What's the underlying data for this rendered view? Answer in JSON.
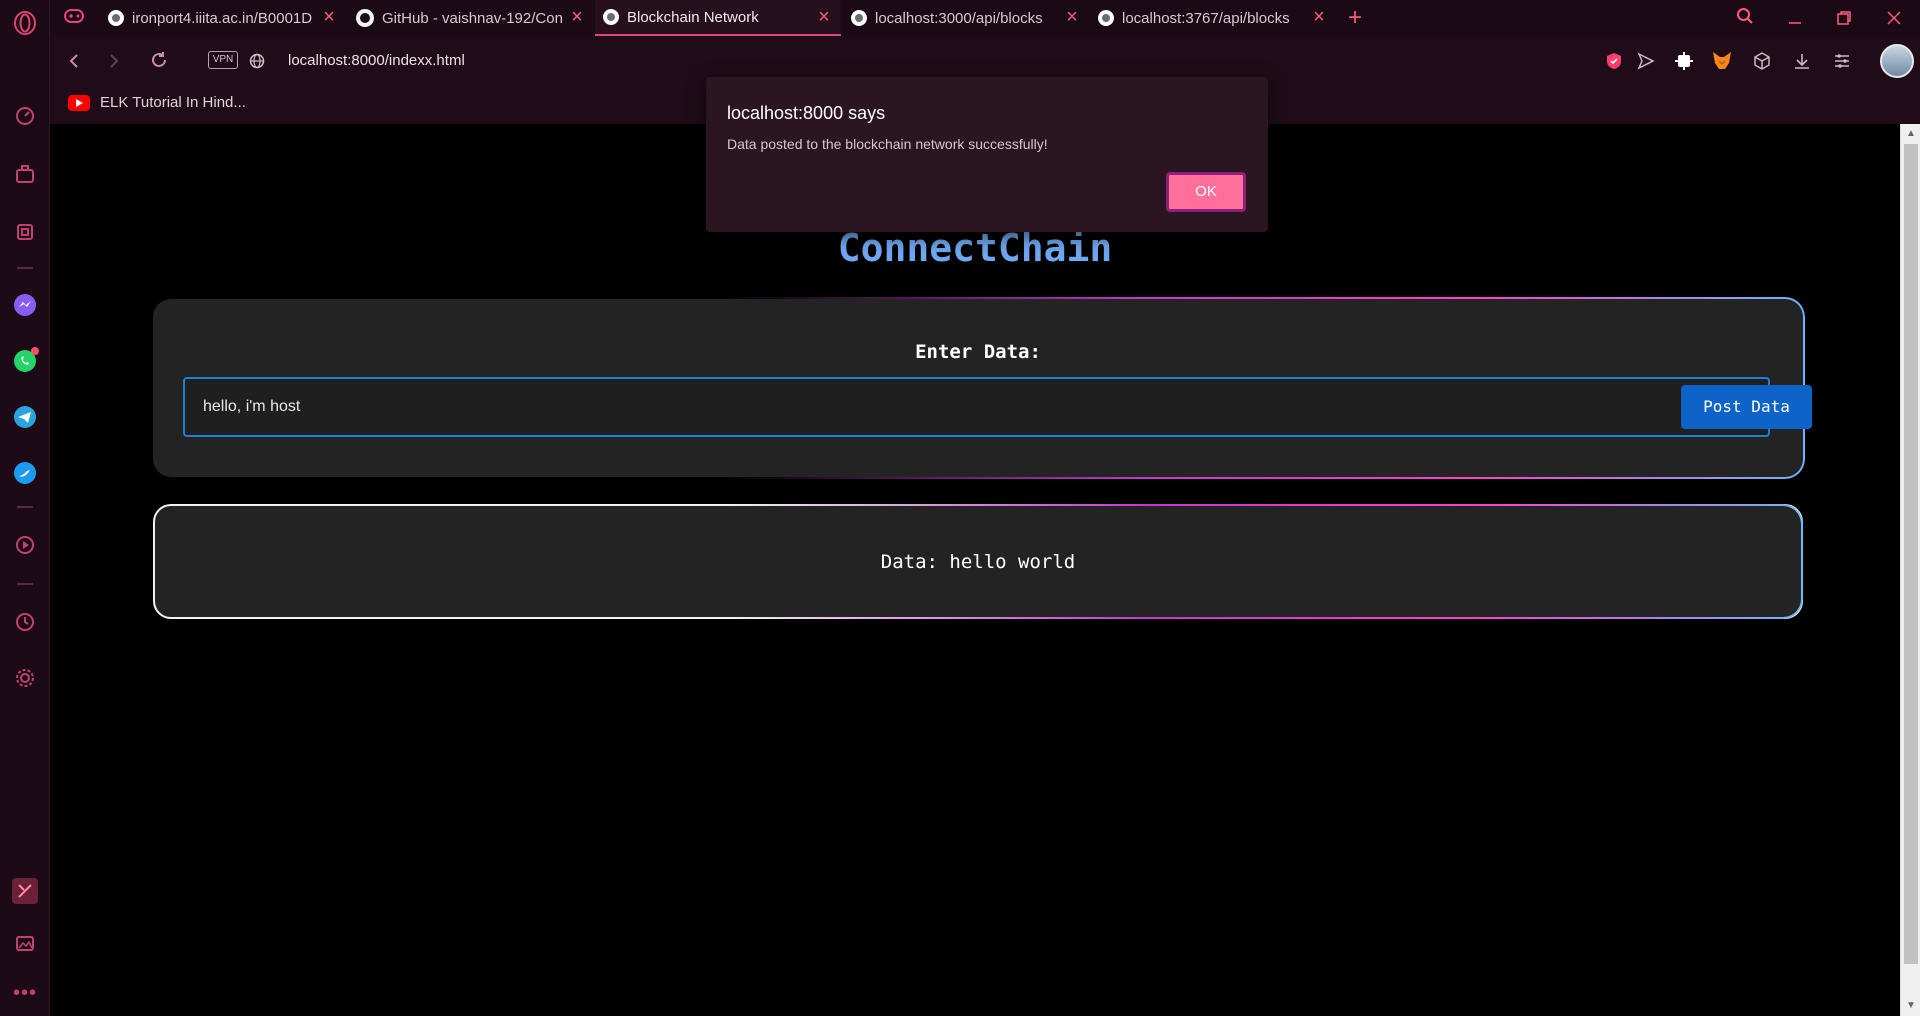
{
  "browser": {
    "tabs": [
      {
        "title": "ironport4.iiita.ac.in/B0001D",
        "icon": "globe-icon"
      },
      {
        "title": "GitHub - vaishnav-192/Con",
        "icon": "github-icon"
      },
      {
        "title": "Blockchain Network",
        "icon": "globe-icon",
        "active": true
      },
      {
        "title": "localhost:3000/api/blocks",
        "icon": "globe-icon"
      },
      {
        "title": "localhost:3767/api/blocks",
        "icon": "globe-icon"
      }
    ],
    "vpn_label": "VPN",
    "url": "localhost:8000/indexx.html",
    "bookmarks": [
      {
        "label": "ELK Tutorial In Hind..."
      }
    ]
  },
  "page": {
    "title": "ConnectChain",
    "input_label": "Enter Data:",
    "input_value": "hello, i'm host",
    "post_button": "Post Data",
    "data_display": "Data: hello world"
  },
  "dialog": {
    "title": "localhost:8000 says",
    "message": "Data posted to the blockchain network successfully!",
    "ok_label": "OK"
  },
  "colors": {
    "accent": "#e0457b",
    "title_blue": "#6fa8f2",
    "button_blue": "#0d63c7",
    "ok_pink": "#ff6f9b"
  }
}
